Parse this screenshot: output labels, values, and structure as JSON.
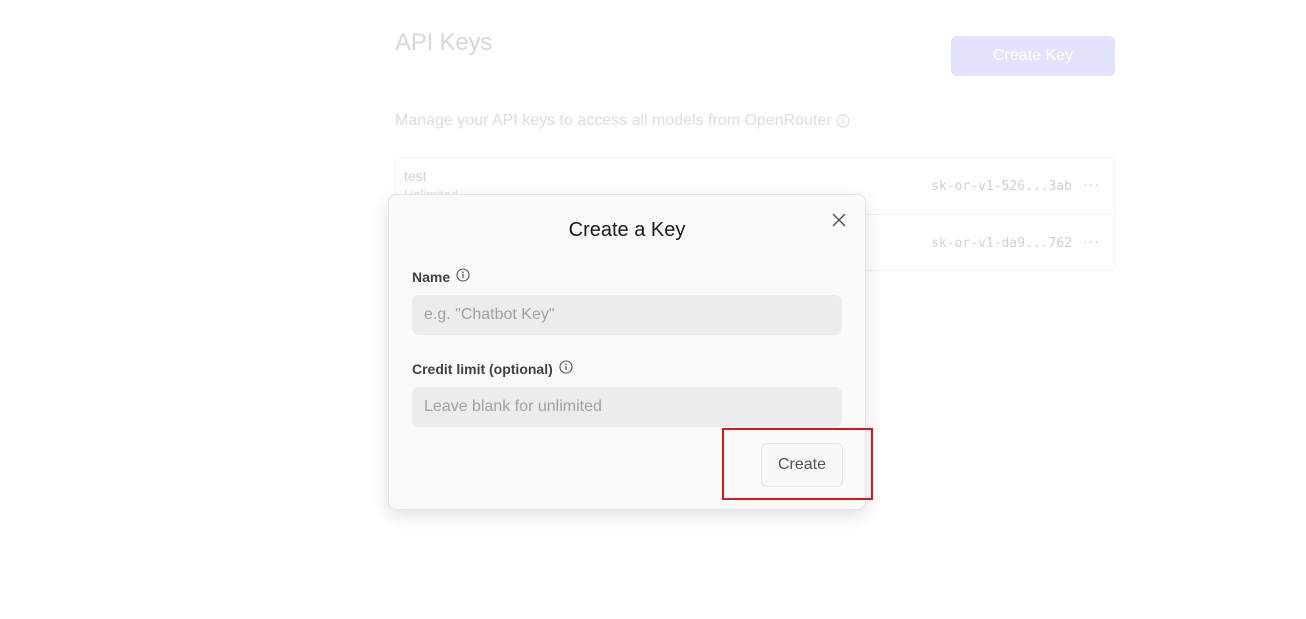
{
  "page": {
    "title": "API Keys",
    "create_key_label": "Create Key",
    "description": "Manage your API keys to access all models from OpenRouter"
  },
  "keys": [
    {
      "name": "test",
      "limit": "Unlimited",
      "secret": "sk-or-v1-526...3ab"
    },
    {
      "name": "",
      "limit": "",
      "secret": "sk-or-v1-da9...762"
    }
  ],
  "modal": {
    "title": "Create a Key",
    "name_label": "Name",
    "name_placeholder": "e.g. \"Chatbot Key\"",
    "name_value": "",
    "credit_label": "Credit limit (optional)",
    "credit_placeholder": "Leave blank for unlimited",
    "credit_value": "",
    "create_label": "Create"
  },
  "icons": {
    "info": "info-circle-icon",
    "close": "close-icon",
    "more": "more-horizontal-icon"
  },
  "colors": {
    "accent_faded": "#e3e3fb",
    "highlight": "#e01515",
    "input_bg": "#ececee"
  }
}
